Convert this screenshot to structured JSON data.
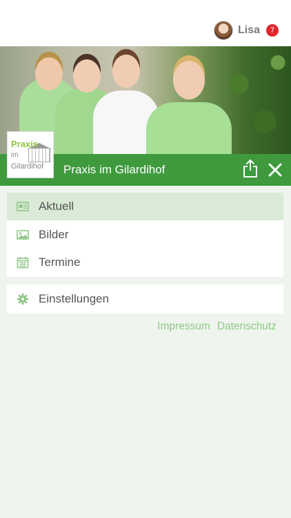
{
  "user": {
    "name": "Lisa",
    "notifications": "7"
  },
  "header": {
    "title": "Praxis im Gilardihof"
  },
  "logo": {
    "line1": "Praxis",
    "line2": "im",
    "line3": "Gilardihof"
  },
  "menu": {
    "items": [
      {
        "label": "Aktuell",
        "icon": "newspaper-icon",
        "active": true
      },
      {
        "label": "Bilder",
        "icon": "image-icon",
        "active": false
      },
      {
        "label": "Termine",
        "icon": "calendar-icon",
        "active": false
      }
    ],
    "settings": {
      "label": "Einstellungen",
      "icon": "gear-icon"
    }
  },
  "footer_links": {
    "impressum": "Impressum",
    "datenschutz": "Datenschutz"
  },
  "colors": {
    "accent": "#3f9a3e",
    "active_row": "#d9ead6",
    "link": "#8fc786",
    "badge": "#e0262b"
  }
}
